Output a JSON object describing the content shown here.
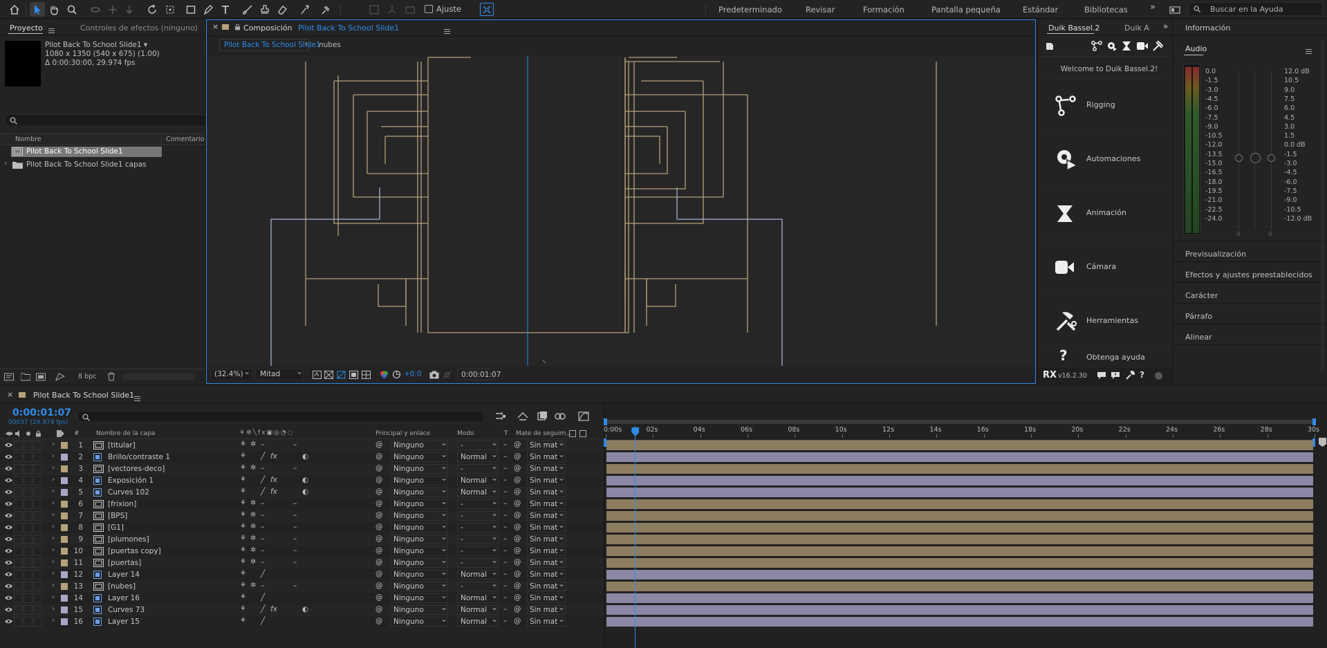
{
  "toolbar": {
    "snap_label": "Ajuste",
    "workspaces": [
      "Predeterminado",
      "Revisar",
      "Formación",
      "Pantalla pequeña",
      "Estándar",
      "Bibliotecas"
    ],
    "more": "»",
    "search_placeholder": "Buscar en la Ayuda"
  },
  "project": {
    "tab_label": "Proyecto",
    "effects_tab_label": "Controles de efectos (ninguno)",
    "item_name": "Pilot Back To School Slide1 ▾",
    "item_size": "1080 x 1350  (540 x 675) (1.00)",
    "item_duration": "Δ 0:00:30:00, 29.974 fps",
    "col_name": "Nombre",
    "col_comment": "Comentario",
    "items": [
      "Pilot Back To School Slide1",
      "Pilot Back To School Slide1 capas"
    ],
    "bpc": "8 bpc"
  },
  "composition": {
    "tab_prefix": "Composición",
    "tab_name": "Pilot Back To School Slide1",
    "breadcrumb_active": "Pilot Back To School Slide1",
    "breadcrumb_next": "nubes",
    "zoom": "(32.4%)",
    "resolution": "Mitad",
    "exposure": "+0.0",
    "timecode": "0:00:01:07"
  },
  "duik": {
    "tab1": "Duik Bassel.2",
    "tab2": "Duik A",
    "welcome": "Welcome to Duik Bassel.2!",
    "items": [
      "Rigging",
      "Automaciones",
      "Animación",
      "Cámara",
      "Herramientas"
    ],
    "help": "Obtenga ayuda",
    "version": "v16.2.30"
  },
  "right_panel": {
    "info": "Información",
    "audio": "Audio",
    "db_left": [
      "0.0",
      "-1.5",
      "-3.0",
      "-4.5",
      "-6.0",
      "-7.5",
      "-9.0",
      "-10.5",
      "-12.0",
      "-13.5",
      "-15.0",
      "-16.5",
      "-18.0",
      "-19.5",
      "-21.0",
      "-22.5",
      "-24.0"
    ],
    "db_right": [
      "12.0 dB",
      "10.5",
      "9.0",
      "7.5",
      "6.0",
      "4.5",
      "3.0",
      "1.5",
      "0.0 dB",
      "-1.5",
      "-3.0",
      "-4.5",
      "-6.0",
      "-7.5",
      "-9.0",
      "-10.5",
      "-12.0 dB"
    ],
    "meter_zero_left": "0",
    "meter_zero_right": "0",
    "sections": [
      "Previsualización",
      "Efectos y ajustes preestablecidos",
      "Carácter",
      "Párrafo",
      "Alinear"
    ]
  },
  "timeline": {
    "tab_name": "Pilot Back To School Slide1",
    "current_time": "0:00:01:07",
    "frame_info": "00037 (29.974 fps)",
    "col_name": "Nombre de la capa",
    "col_parent": "Principal y enlace",
    "col_mode": "Modo",
    "col_t": "T",
    "col_matte": "Mate de seguim...",
    "ruler": [
      "0:00s",
      "02s",
      "04s",
      "06s",
      "08s",
      "10s",
      "12s",
      "14s",
      "16s",
      "18s",
      "20s",
      "22s",
      "24s",
      "26s",
      "28s",
      "30s"
    ],
    "playhead_seconds": 1.24,
    "duration_seconds": 30,
    "layers": [
      {
        "num": "1",
        "name": "[titular]",
        "kind": "precomp",
        "mode": "-",
        "parent": "Ninguno",
        "matte": "Sin mat",
        "fx": false,
        "adj": false
      },
      {
        "num": "2",
        "name": "Brillo/contraste 1",
        "kind": "adjust",
        "mode": "Normal",
        "parent": "Ninguno",
        "matte": "Sin mat",
        "fx": true,
        "adj": true
      },
      {
        "num": "3",
        "name": "[vectores-deco]",
        "kind": "precomp",
        "mode": "-",
        "parent": "Ninguno",
        "matte": "Sin mat",
        "fx": false,
        "adj": false
      },
      {
        "num": "4",
        "name": "Exposición 1",
        "kind": "adjust",
        "mode": "Normal",
        "parent": "Ninguno",
        "matte": "Sin mat",
        "fx": true,
        "adj": true
      },
      {
        "num": "5",
        "name": "Curves 102",
        "kind": "adjust",
        "mode": "Normal",
        "parent": "Ninguno",
        "matte": "Sin mat",
        "fx": true,
        "adj": true
      },
      {
        "num": "6",
        "name": "[frixion]",
        "kind": "precomp",
        "mode": "-",
        "parent": "Ninguno",
        "matte": "Sin mat",
        "fx": false,
        "adj": false
      },
      {
        "num": "7",
        "name": "[BPS]",
        "kind": "precomp",
        "mode": "-",
        "parent": "Ninguno",
        "matte": "Sin mat",
        "fx": false,
        "adj": false
      },
      {
        "num": "8",
        "name": "[G1]",
        "kind": "precomp",
        "mode": "-",
        "parent": "Ninguno",
        "matte": "Sin mat",
        "fx": false,
        "adj": false
      },
      {
        "num": "9",
        "name": "[plumones]",
        "kind": "precomp",
        "mode": "-",
        "parent": "Ninguno",
        "matte": "Sin mat",
        "fx": false,
        "adj": false
      },
      {
        "num": "10",
        "name": "[puertas copy]",
        "kind": "precomp",
        "mode": "-",
        "parent": "Ninguno",
        "matte": "Sin mat",
        "fx": false,
        "adj": false
      },
      {
        "num": "11",
        "name": "[puertas]",
        "kind": "precomp",
        "mode": "-",
        "parent": "Ninguno",
        "matte": "Sin mat",
        "fx": false,
        "adj": false
      },
      {
        "num": "12",
        "name": "Layer 14",
        "kind": "adjust",
        "mode": "Normal",
        "parent": "Ninguno",
        "matte": "Sin mat",
        "fx": false,
        "adj": false
      },
      {
        "num": "13",
        "name": "[nubes]",
        "kind": "precomp",
        "mode": "-",
        "parent": "Ninguno",
        "matte": "Sin mat",
        "fx": false,
        "adj": false
      },
      {
        "num": "14",
        "name": "Layer 16",
        "kind": "adjust",
        "mode": "Normal",
        "parent": "Ninguno",
        "matte": "Sin mat",
        "fx": false,
        "adj": false
      },
      {
        "num": "15",
        "name": "Curves 73",
        "kind": "adjust",
        "mode": "Normal",
        "parent": "Ninguno",
        "matte": "Sin mat",
        "fx": true,
        "adj": true
      },
      {
        "num": "16",
        "name": "Layer 15",
        "kind": "adjust",
        "mode": "Normal",
        "parent": "Ninguno",
        "matte": "Sin mat",
        "fx": false,
        "adj": false
      }
    ]
  },
  "colors": {
    "precomp_label": "#b5a17a",
    "adjust_label": "#a9a6c8",
    "precomp_bar": "#8d7d60",
    "adjust_bar": "#8a88a4",
    "accent": "#2d8ceb"
  }
}
